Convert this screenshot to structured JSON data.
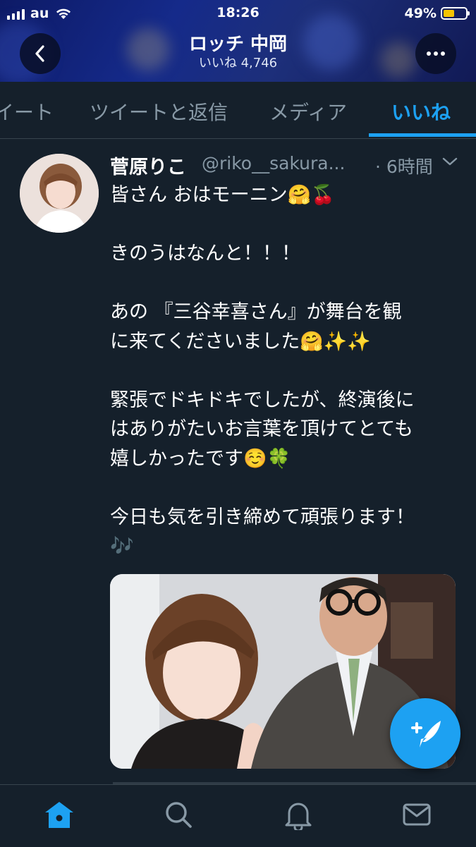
{
  "status_bar": {
    "carrier": "au",
    "time": "18:26",
    "battery_percent": "49%",
    "battery_level": 0.49,
    "icons": [
      "signal-icon",
      "wifi-icon",
      "battery-icon"
    ]
  },
  "header": {
    "title": "ロッチ 中岡",
    "subtitle": "いいね 4,746",
    "back_icon": "chevron-left-icon",
    "more_icon": "more-icon"
  },
  "tabs": [
    {
      "label": "ツイート",
      "visible_label": "イート"
    },
    {
      "label": "ツイートと返信"
    },
    {
      "label": "メディア"
    },
    {
      "label": "いいね",
      "active": true
    }
  ],
  "tweet": {
    "author_name": "菅原りこ",
    "handle": "@riko__sakura...",
    "time": "· 6時間",
    "caret_icon": "chevron-down-icon",
    "lines": [
      "皆さん おはモーニン🤗🍒",
      "",
      "きのうはなんと！！！",
      "",
      "あの 『三谷幸喜さん』が舞台を観",
      "に来てくださいました🤗✨✨",
      "",
      "緊張でドキドキでしたが、終演後に",
      "はありがたいお言葉を頂けてとても",
      "嬉しかったです☺️🍀",
      "",
      "今日も気を引き締めて頑張ります！",
      "🎶"
    ],
    "media": "photo"
  },
  "fab": {
    "icon": "compose-tweet-icon"
  },
  "bottom_nav": [
    {
      "name": "home-icon",
      "active": true
    },
    {
      "name": "search-icon"
    },
    {
      "name": "notifications-icon"
    },
    {
      "name": "messages-icon"
    }
  ],
  "colors": {
    "background": "#15202b",
    "accent": "#1da1f2",
    "muted_text": "#8899a6",
    "divider": "#38444d",
    "battery": "#f5c400"
  }
}
